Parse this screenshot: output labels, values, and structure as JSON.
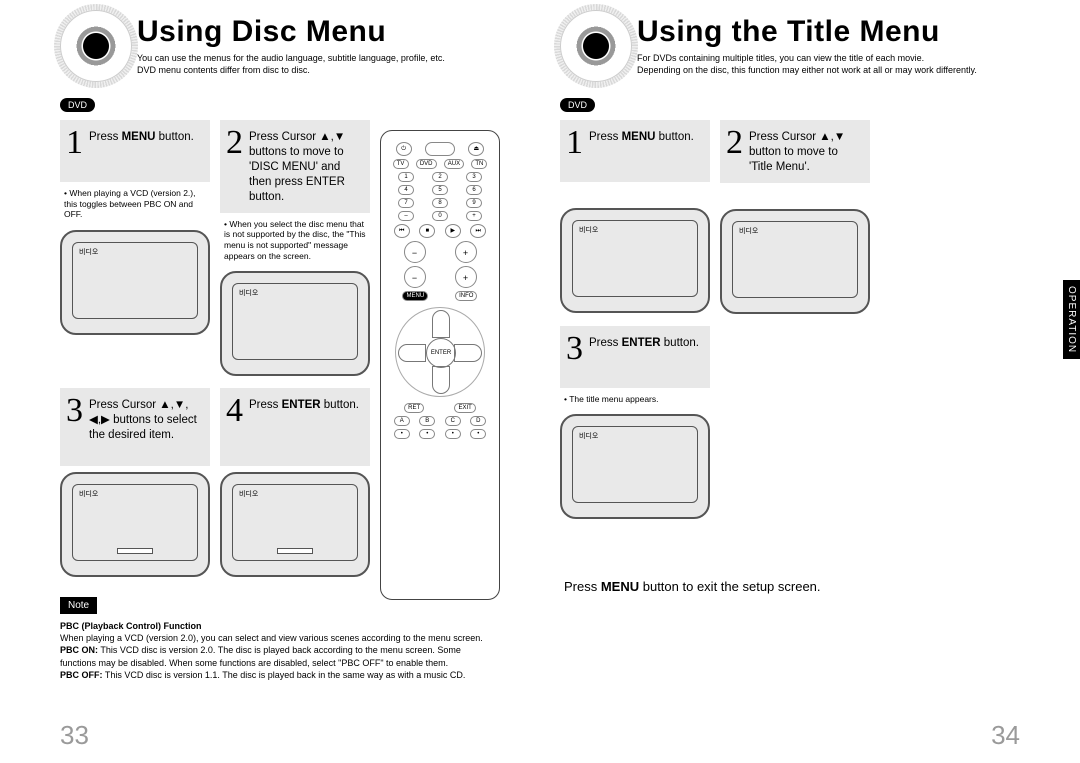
{
  "left": {
    "title": "Using Disc Menu",
    "subtitle1": "You can use the menus for the audio language, subtitle language, profile, etc.",
    "subtitle2": "DVD menu contents differ from disc to disc.",
    "badge": "DVD",
    "steps": {
      "s1": {
        "num": "1",
        "text_a": "Press ",
        "text_b": "MENU",
        "text_c": " button.",
        "note": "When playing a VCD (version 2.), this toggles between PBC ON and OFF."
      },
      "s2": {
        "num": "2",
        "text": "Press Cursor ▲,▼ buttons to move to 'DISC MENU' and then press ENTER button.",
        "note": "When you select the disc menu that is not supported by the disc, the \"This menu is not supported\" message appears on the screen."
      },
      "s3": {
        "num": "3",
        "text": "Press Cursor ▲,▼, ◀,▶ buttons to select the desired item."
      },
      "s4": {
        "num": "4",
        "text_a": "Press ",
        "text_b": "ENTER",
        "text_c": " button."
      }
    },
    "tv_label": "비디오",
    "note_label": "Note",
    "note_title": "PBC (Playback Control) Function",
    "note_line": "When playing a VCD (version 2.0), you can select and view various scenes according to the menu screen.",
    "note_on_label": "PBC ON:",
    "note_on": "This VCD disc is version 2.0. The disc is played back according to the menu screen. Some functions may be disabled. When some functions are disabled, select \"PBC OFF\" to enable them.",
    "note_off_label": "PBC OFF:",
    "note_off": "This VCD disc is version 1.1. The disc is played back in the same way as with a music CD.",
    "page_num": "33"
  },
  "right": {
    "title": "Using the Title Menu",
    "subtitle1": "For DVDs containing multiple titles, you can view the title of each movie.",
    "subtitle2": "Depending on the disc, this function may either not work at all or may work differently.",
    "badge": "DVD",
    "steps": {
      "s1": {
        "num": "1",
        "text_a": "Press ",
        "text_b": "MENU",
        "text_c": " button."
      },
      "s2": {
        "num": "2",
        "text": "Press Cursor ▲,▼ button to move to 'Title Menu'."
      },
      "s3": {
        "num": "3",
        "text_a": "Press ",
        "text_b": "ENTER",
        "text_c": " button.",
        "note": "The title menu appears."
      }
    },
    "tv_label": "비디오",
    "exit_a": "Press ",
    "exit_b": "MENU",
    "exit_c": " button to exit the setup screen.",
    "side_tab": "OPERATION",
    "page_num": "34"
  },
  "remote": {
    "enter": "ENTER"
  }
}
